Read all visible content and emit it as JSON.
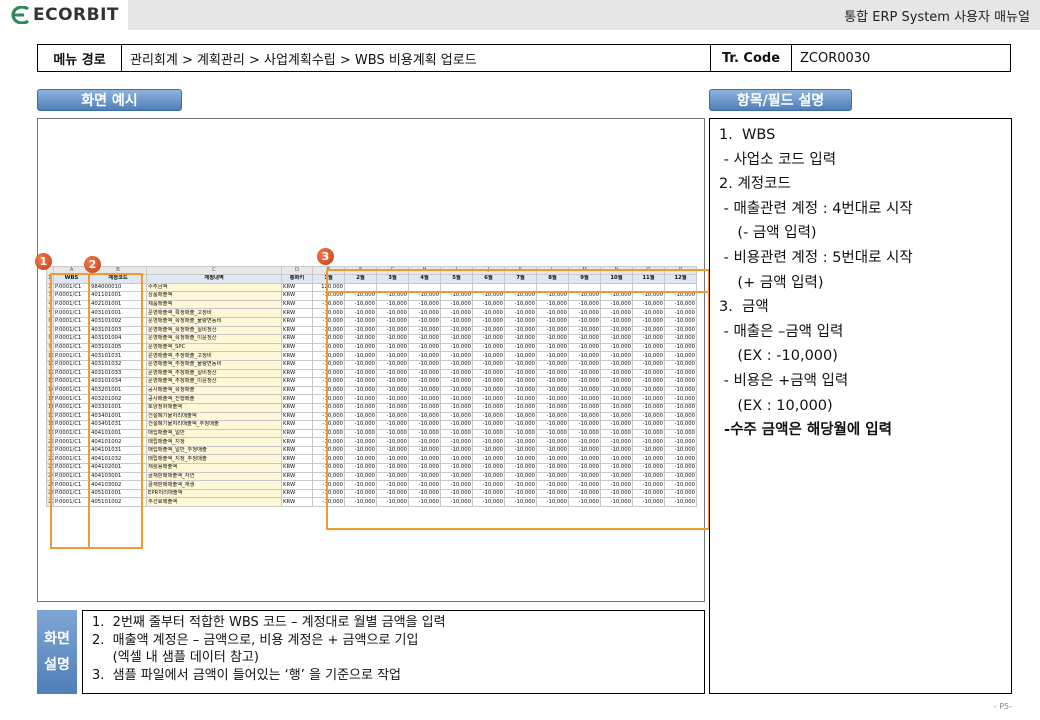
{
  "header": {
    "logo_text": "ECORBIT",
    "title": "통합 ERP System 사용자 매뉴얼",
    "brand_color": "#2e8b57"
  },
  "menu_path": {
    "label": "메뉴 경로",
    "path": "관리회계 > 계획관리 > 사업계획수립 > WBS 비용계획 업로드",
    "tr_label": "Tr. Code",
    "tr_code": "ZCOR0030"
  },
  "sections": {
    "screen_example": "화면 예시",
    "field_desc": "항목/필드 설명",
    "screen_desc_line1": "화면",
    "screen_desc_line2": "설명"
  },
  "spreadsheet": {
    "col_letters": [
      "A",
      "B",
      "C",
      "D",
      "E",
      "F",
      "G",
      "H",
      "I",
      "J",
      "K",
      "L",
      "M",
      "N",
      "O",
      "P"
    ],
    "headers": [
      "WBS",
      "계정코드",
      "계정내역",
      "통화키",
      "1월",
      "2월",
      "3월",
      "4월",
      "5월",
      "6월",
      "7월",
      "8월",
      "9월",
      "10월",
      "11월",
      "12월"
    ],
    "rows": [
      {
        "n": "2",
        "wbs": "P.0001/C1",
        "acct": "984000010",
        "name": "수주금액",
        "cur": "KRW",
        "amt": "120,000"
      },
      {
        "n": "3",
        "wbs": "P.0001/C1",
        "acct": "401101001",
        "name": "상품매출액",
        "cur": "KRW",
        "amt": "-10,000"
      },
      {
        "n": "4",
        "wbs": "P.0001/C1",
        "acct": "402101001",
        "name": "제품매출액",
        "cur": "KRW",
        "amt": "-10,000"
      },
      {
        "n": "5",
        "wbs": "P.0001/C1",
        "acct": "403101001",
        "name": "운영매출액_확정매출_고정비",
        "cur": "KRW",
        "amt": "-10,000"
      },
      {
        "n": "6",
        "wbs": "P.0001/C1",
        "acct": "403101002",
        "name": "운영매출액_확정매출_물량변동비",
        "cur": "KRW",
        "amt": "-10,000"
      },
      {
        "n": "7",
        "wbs": "P.0001/C1",
        "acct": "403101003",
        "name": "운영매출액_확정매출_실비정산",
        "cur": "KRW",
        "amt": "-10,000"
      },
      {
        "n": "8",
        "wbs": "P.0001/C1",
        "acct": "403101004",
        "name": "운영매출액_확정매출_이윤정산",
        "cur": "KRW",
        "amt": "-10,000"
      },
      {
        "n": "9",
        "wbs": "P.0001/C1",
        "acct": "403101005",
        "name": "운영매출액_SPC",
        "cur": "KRW",
        "amt": "-10,000"
      },
      {
        "n": "10",
        "wbs": "P.0001/C1",
        "acct": "403101031",
        "name": "운영매출액_추정매출_고정비",
        "cur": "KRW",
        "amt": "-10,000"
      },
      {
        "n": "11",
        "wbs": "P.0001/C1",
        "acct": "403101032",
        "name": "운영매출액_추정매출_물량변동비",
        "cur": "KRW",
        "amt": "-10,000"
      },
      {
        "n": "12",
        "wbs": "P.0001/C1",
        "acct": "403101033",
        "name": "운영매출액_추정매출_실비정산",
        "cur": "KRW",
        "amt": "-10,000"
      },
      {
        "n": "13",
        "wbs": "P.0001/C1",
        "acct": "403101034",
        "name": "운영매출액_추정매출_이윤정산",
        "cur": "KRW",
        "amt": "-10,000"
      },
      {
        "n": "14",
        "wbs": "P.0001/C1",
        "acct": "403201001",
        "name": "공사매출액_확정매출",
        "cur": "KRW",
        "amt": "-10,000"
      },
      {
        "n": "15",
        "wbs": "P.0001/C1",
        "acct": "403201002",
        "name": "공사매출액_진행매출",
        "cur": "KRW",
        "amt": "-10,000"
      },
      {
        "n": "16",
        "wbs": "P.0001/C1",
        "acct": "403301001",
        "name": "토양정화매출액",
        "cur": "KRW",
        "amt": "-10,000"
      },
      {
        "n": "17",
        "wbs": "P.0001/C1",
        "acct": "403401001",
        "name": "건설폐기물처리매출액",
        "cur": "KRW",
        "amt": "-10,000"
      },
      {
        "n": "18",
        "wbs": "P.0001/C1",
        "acct": "403401031",
        "name": "건설폐기물처리매출액_추정매출",
        "cur": "KRW",
        "amt": "-10,000"
      },
      {
        "n": "19",
        "wbs": "P.0001/C1",
        "acct": "404101001",
        "name": "매립매출액_일반",
        "cur": "KRW",
        "amt": "-10,000"
      },
      {
        "n": "20",
        "wbs": "P.0001/C1",
        "acct": "404101002",
        "name": "매립매출액_지정",
        "cur": "KRW",
        "amt": "-10,000"
      },
      {
        "n": "21",
        "wbs": "P.0001/C1",
        "acct": "404101031",
        "name": "매립매출액_일반_추정매출",
        "cur": "KRW",
        "amt": "-10,000"
      },
      {
        "n": "22",
        "wbs": "P.0001/C1",
        "acct": "404101032",
        "name": "매립매출액_지정_추정매출",
        "cur": "KRW",
        "amt": "-10,000"
      },
      {
        "n": "23",
        "wbs": "P.0001/C1",
        "acct": "404102001",
        "name": "재활용매출액",
        "cur": "KRW",
        "amt": "-10,000"
      },
      {
        "n": "24",
        "wbs": "P.0001/C1",
        "acct": "404103001",
        "name": "골재판매매출액_자연",
        "cur": "KRW",
        "amt": "-10,000"
      },
      {
        "n": "25",
        "wbs": "P.0001/C1",
        "acct": "404103002",
        "name": "골재판매매출액_재생",
        "cur": "KRW",
        "amt": "-10,000"
      },
      {
        "n": "26",
        "wbs": "P.0001/C1",
        "acct": "405101001",
        "name": "EPR처리매출액",
        "cur": "KRW",
        "amt": "-10,000"
      },
      {
        "n": "27",
        "wbs": "P.0001/C1",
        "acct": "405101002",
        "name": "주선료매출액",
        "cur": "KRW",
        "amt": "-10,000"
      }
    ]
  },
  "badges": [
    "1",
    "2",
    "3"
  ],
  "field_panel": [
    {
      "text": "1.  WBS",
      "bold": false
    },
    {
      "text": " - 사업소 코드 입력",
      "bold": false
    },
    {
      "text": "2. 계정코드",
      "bold": false
    },
    {
      "text": " - 매출관련 계정 : 4번대로 시작",
      "bold": false
    },
    {
      "text": "    (- 금액 입력)",
      "bold": false
    },
    {
      "text": " - 비용관련 계정 : 5번대로 시작",
      "bold": false
    },
    {
      "text": "    (+ 금액 입력)",
      "bold": false
    },
    {
      "text": "3.  금액",
      "bold": false
    },
    {
      "text": " - 매출은 –금액 입력",
      "bold": false
    },
    {
      "text": "    (EX : -10,000)",
      "bold": false
    },
    {
      "text": " - 비용은 +금액 입력",
      "bold": false
    },
    {
      "text": "    (EX : 10,000)",
      "bold": false
    },
    {
      "text": " -수주 금액은 해당월에 입력",
      "bold": true
    }
  ],
  "screen_desc": [
    "1.  2번째 줄부터 적합한 WBS 코드 – 계정대로 월별 금액을 입력",
    "2.  매출액 계정은 – 금액으로, 비용 계정은 + 금액으로 기입",
    "     (엑셀 내 샘플 데이터 참고)",
    "3.  샘플 파일에서 금액이 들어있는 ‘행’ 을 기준으로 작업"
  ],
  "page_number": "- P5-"
}
